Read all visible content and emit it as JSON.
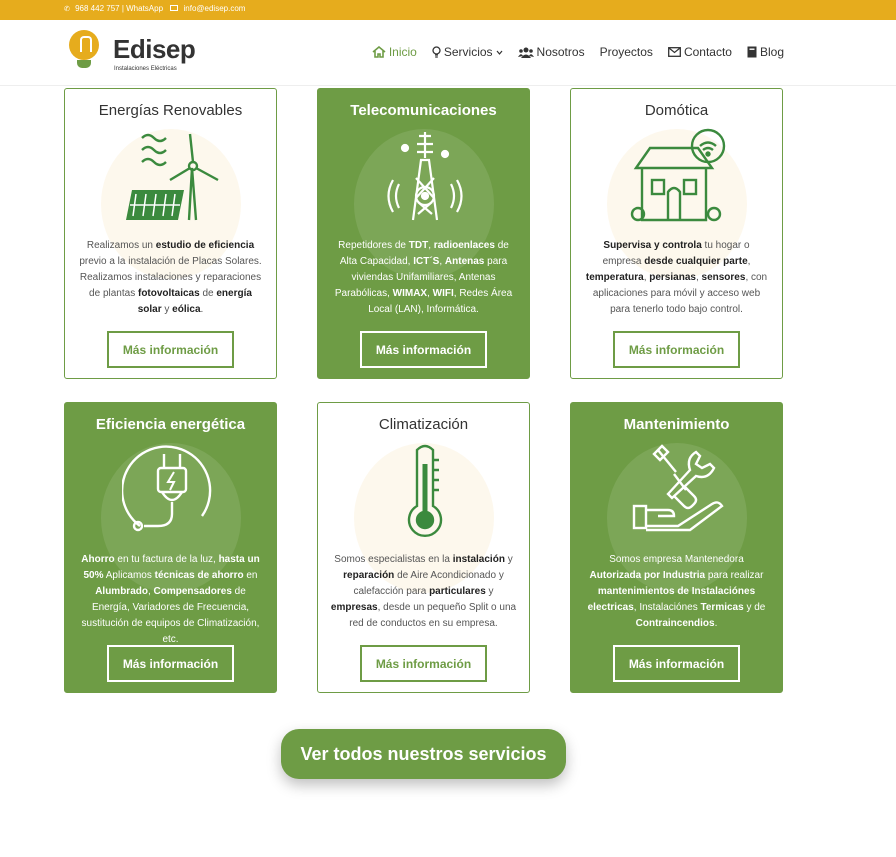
{
  "topbar": {
    "phone": "968 442 757 | WhatsApp",
    "email": "info@edisep.com"
  },
  "logo": {
    "name": "Edisep",
    "tagline": "Instalaciones Eléctricas"
  },
  "nav": [
    {
      "label": "Inicio",
      "icon": "home-icon"
    },
    {
      "label": "Servicios",
      "icon": "lightbulb-icon"
    },
    {
      "label": "Nosotros",
      "icon": "users-icon"
    },
    {
      "label": "Proyectos"
    },
    {
      "label": "Contacto",
      "icon": "envelope-icon"
    },
    {
      "label": "Blog",
      "icon": "book-icon"
    }
  ],
  "cards": [
    {
      "title": "Energías Renovables",
      "button": "Más información",
      "icon": "renewable-energy-icon",
      "text": [
        {
          "t": "Realizamos un "
        },
        {
          "b": "estudio de eficiencia"
        },
        {
          "t": " previo a la instalación de Placas Solares. Realizamos instalaciones y reparaciones de plantas "
        },
        {
          "b": "fotovoltaicas"
        },
        {
          "t": " de "
        },
        {
          "b": "energía solar"
        },
        {
          "t": " y "
        },
        {
          "b": "eólica"
        },
        {
          "t": "."
        }
      ]
    },
    {
      "title": "Telecomunicaciones",
      "button": "Más información",
      "icon": "antenna-tower-icon",
      "text": [
        {
          "t": "Repetidores de "
        },
        {
          "b": "TDT"
        },
        {
          "t": ", "
        },
        {
          "b": "radioenlaces"
        },
        {
          "t": " de Alta Capacidad, "
        },
        {
          "b": "ICT´S"
        },
        {
          "t": ", "
        },
        {
          "b": "Antenas"
        },
        {
          "t": " para viviendas Unifamiliares, Antenas Parabólicas, "
        },
        {
          "b": "WIMAX"
        },
        {
          "t": ", "
        },
        {
          "b": "WIFI"
        },
        {
          "t": ", Redes Área Local (LAN), Informática."
        }
      ]
    },
    {
      "title": "Domótica",
      "button": "Más información",
      "icon": "smart-home-icon",
      "text": [
        {
          "b": "Supervisa y controla"
        },
        {
          "t": " tu hogar o empresa "
        },
        {
          "b": "desde cualquier parte"
        },
        {
          "t": ", "
        },
        {
          "b": "temperatura"
        },
        {
          "t": ", "
        },
        {
          "b": "persianas"
        },
        {
          "t": ", "
        },
        {
          "b": "sensores"
        },
        {
          "t": ",  con aplicaciones para móvil y acceso web para tenerlo todo bajo control."
        }
      ]
    },
    {
      "title": "Eficiencia energética",
      "button": "Más información",
      "icon": "power-plug-icon",
      "text": [
        {
          "b": "Ahorro"
        },
        {
          "t": " en tu factura de la luz, "
        },
        {
          "b": "hasta un 50%"
        },
        {
          "t": " Aplicamos "
        },
        {
          "b": "técnicas de ahorro"
        },
        {
          "t": " en "
        },
        {
          "b": "Alumbrado"
        },
        {
          "t": ", "
        },
        {
          "b": "Compensadores"
        },
        {
          "t": " de Energía, Variadores de Frecuencia, sustitución de equipos de Climatización, etc."
        }
      ]
    },
    {
      "title": "Climatización",
      "button": "Más información",
      "icon": "thermometer-icon",
      "text": [
        {
          "t": "Somos especialistas en la "
        },
        {
          "b": "instalación"
        },
        {
          "t": " y "
        },
        {
          "b": "reparación"
        },
        {
          "t": " de Aire Acondicionado y calefacción para "
        },
        {
          "b": "particulares"
        },
        {
          "t": " y "
        },
        {
          "b": "empresas"
        },
        {
          "t": ", desde un pequeño Split o una red de conductos en su empresa."
        }
      ]
    },
    {
      "title": "Mantenimiento",
      "button": "Más información",
      "icon": "maintenance-tools-icon",
      "text": [
        {
          "t": "Somos empresa Mantenedora "
        },
        {
          "b": "Autorizada por Industria"
        },
        {
          "t": " para realizar "
        },
        {
          "b": "mantenimientos de Instalaciónes electricas"
        },
        {
          "t": ", Instalaciónes "
        },
        {
          "b": "Termicas"
        },
        {
          "t": " y de "
        },
        {
          "b": "Contraincendios"
        },
        {
          "t": "."
        }
      ]
    }
  ],
  "cta": {
    "label": "Ver todos nuestros servicios"
  },
  "colors": {
    "brand_green": "#6e9c45",
    "brand_yellow": "#e6ac1d"
  }
}
